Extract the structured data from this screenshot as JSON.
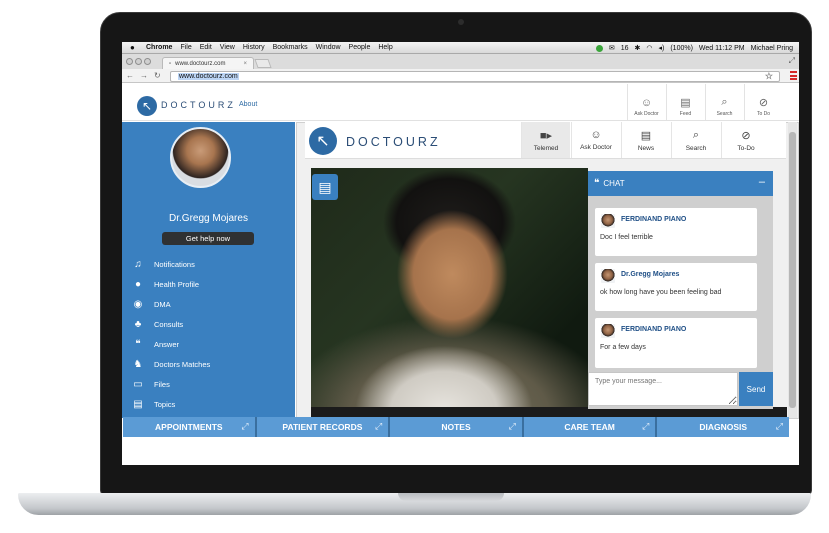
{
  "menubar": {
    "apple": "",
    "items": [
      "Chrome",
      "File",
      "Edit",
      "View",
      "History",
      "Bookmarks",
      "Window",
      "People",
      "Help"
    ],
    "battery": "(100%)",
    "clock": "Wed 11:12 PM",
    "user": "Michael Pring",
    "badge": "16"
  },
  "browser": {
    "tab_title": "www.doctourz.com",
    "url": "www.doctourz.com"
  },
  "site_header": {
    "logo": "DOCTOURZ",
    "about": "About",
    "items": [
      {
        "label": "Ask Doctor",
        "icon": "doctor-icon"
      },
      {
        "label": "Feed",
        "icon": "feed-icon"
      },
      {
        "label": "Search",
        "icon": "search-icon"
      },
      {
        "label": "To Do",
        "icon": "todo-icon"
      }
    ]
  },
  "sidebar": {
    "doctor_name": "Dr.Gregg Mojares",
    "help_button": "Get help now",
    "items": [
      {
        "label": "Notifications",
        "icon": "bell-icon"
      },
      {
        "label": "Health Profile",
        "icon": "person-icon"
      },
      {
        "label": "DMA",
        "icon": "globe-icon"
      },
      {
        "label": "Consults",
        "icon": "group-icon"
      },
      {
        "label": "Answer",
        "icon": "chat-bubbles-icon"
      },
      {
        "label": "Doctors Matches",
        "icon": "users-icon"
      },
      {
        "label": "Files",
        "icon": "folder-icon"
      },
      {
        "label": "Topics",
        "icon": "document-icon"
      }
    ]
  },
  "app": {
    "logo": "DOCTOURZ",
    "tools": [
      {
        "label": "Telemed",
        "icon": "video-camera-icon"
      },
      {
        "label": "Ask Doctor",
        "icon": "doctor-icon"
      },
      {
        "label": "News",
        "icon": "news-icon"
      },
      {
        "label": "Search",
        "icon": "search-icon"
      },
      {
        "label": "To-Do",
        "icon": "todo-icon"
      }
    ]
  },
  "chat": {
    "title": "CHAT",
    "minimize": "–",
    "messages": [
      {
        "sender": "FERDINAND PIANO",
        "text": "Doc I feel terrible"
      },
      {
        "sender": "Dr.Gregg Mojares",
        "text": "ok how long have you been feeling bad"
      },
      {
        "sender": "FERDINAND PIANO",
        "text": "For a few days"
      }
    ],
    "input_placeholder": "Type your message...",
    "send": "Send"
  },
  "bottom_tabs": [
    "APPOINTMENTS",
    "PATIENT RECORDS",
    "NOTES",
    "CARE TEAM",
    "DIAGNOSIS"
  ],
  "colors": {
    "primary": "#3a80c0",
    "bottom_tabs": "#5b9bd5",
    "dark_button": "#2f3132",
    "sender": "#1f4f86"
  }
}
